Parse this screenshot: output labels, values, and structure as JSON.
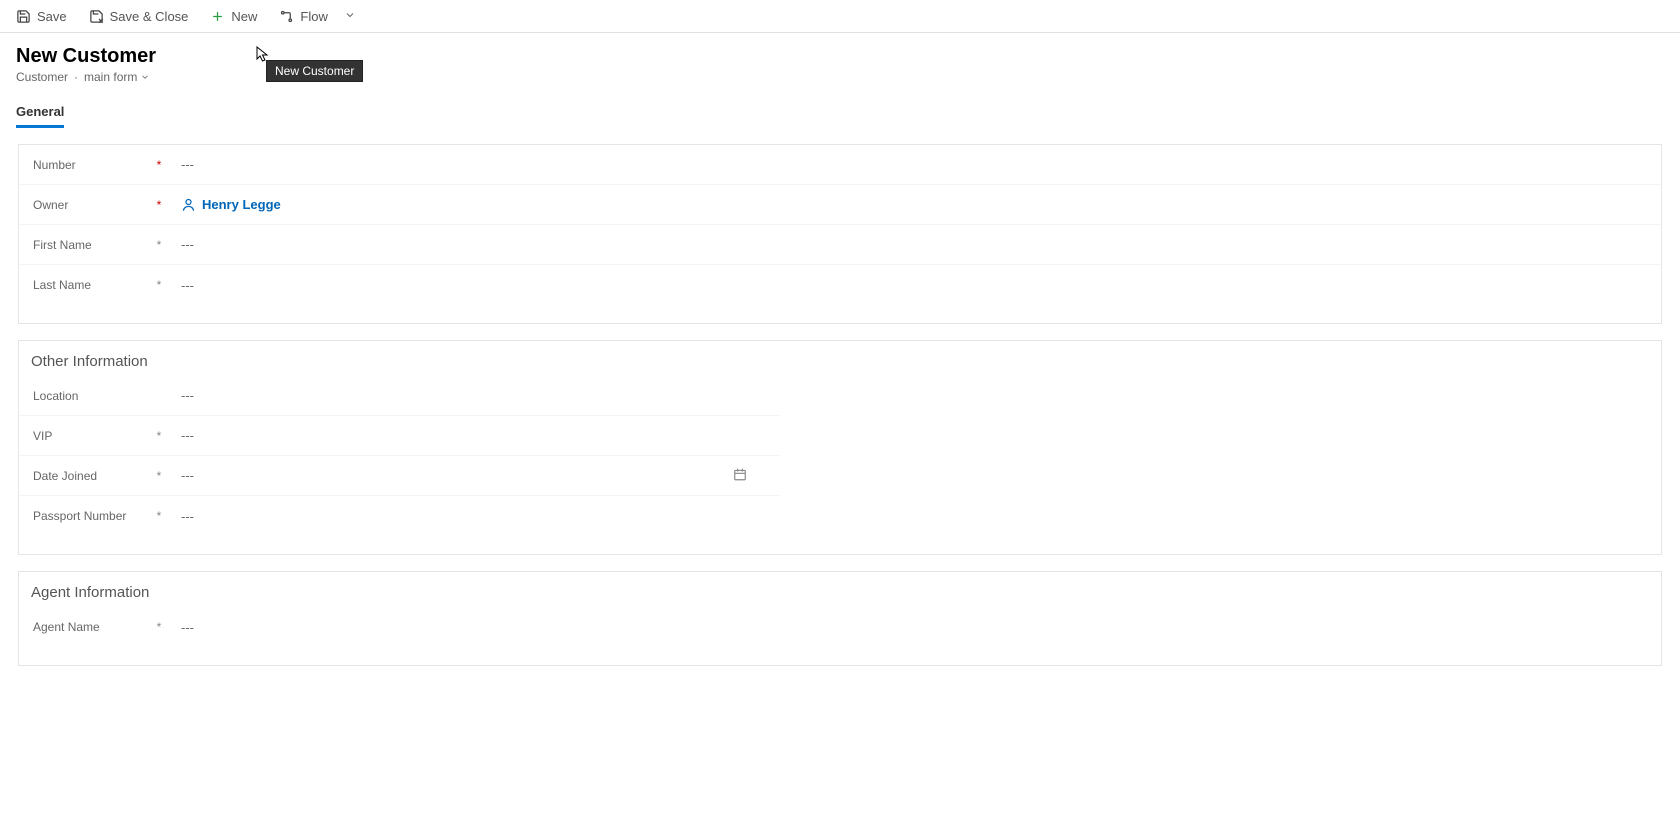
{
  "commandBar": {
    "save": "Save",
    "saveClose": "Save & Close",
    "new": "New",
    "flow": "Flow"
  },
  "header": {
    "title": "New Customer",
    "entity": "Customer",
    "formSelector": "main form",
    "tooltip": "New Customer"
  },
  "tabs": [
    {
      "label": "General",
      "active": true
    }
  ],
  "sections": {
    "general": {
      "fields": {
        "number": {
          "label": "Number",
          "required": "red",
          "placeholder": "---"
        },
        "owner": {
          "label": "Owner",
          "required": "red",
          "value": "Henry Legge"
        },
        "firstName": {
          "label": "First Name",
          "required": "grey",
          "placeholder": "---"
        },
        "lastName": {
          "label": "Last Name",
          "required": "grey",
          "placeholder": "---"
        }
      }
    },
    "other": {
      "title": "Other Information",
      "fields": {
        "location": {
          "label": "Location",
          "required": "none",
          "placeholder": "---"
        },
        "vip": {
          "label": "VIP",
          "required": "grey",
          "placeholder": "---"
        },
        "dateJoined": {
          "label": "Date Joined",
          "required": "grey",
          "placeholder": "---"
        },
        "passport": {
          "label": "Passport Number",
          "required": "grey",
          "placeholder": "---"
        }
      }
    },
    "agent": {
      "title": "Agent Information",
      "fields": {
        "agentName": {
          "label": "Agent Name",
          "required": "grey",
          "placeholder": "---"
        }
      }
    }
  }
}
